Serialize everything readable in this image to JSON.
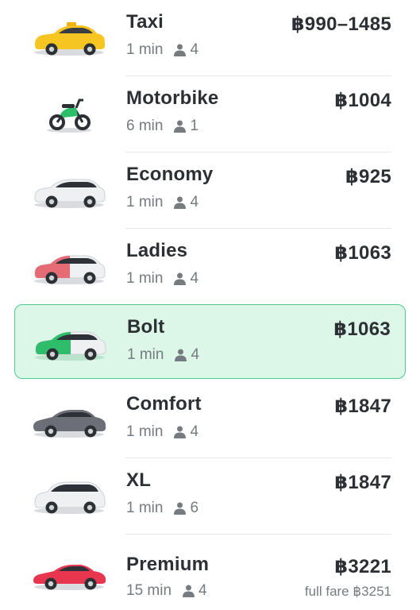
{
  "options": [
    {
      "name": "Taxi",
      "eta": "1 min",
      "seats": "4",
      "price": "฿990–1485",
      "icon": "taxi-car-icon",
      "color": "#f6c522"
    },
    {
      "name": "Motorbike",
      "eta": "6 min",
      "seats": "1",
      "price": "฿1004",
      "icon": "motorbike-icon",
      "color": "#2bbf6a"
    },
    {
      "name": "Economy",
      "eta": "1 min",
      "seats": "4",
      "price": "฿925",
      "icon": "economy-car-icon",
      "color": "#eef0f2"
    },
    {
      "name": "Ladies",
      "eta": "1 min",
      "seats": "4",
      "price": "฿1063",
      "icon": "ladies-car-icon",
      "color": "#e56b74"
    },
    {
      "name": "Bolt",
      "eta": "1 min",
      "seats": "4",
      "price": "฿1063",
      "icon": "bolt-car-icon",
      "color": "#2ebd6b",
      "selected": true
    },
    {
      "name": "Comfort",
      "eta": "1 min",
      "seats": "4",
      "price": "฿1847",
      "icon": "comfort-car-icon",
      "color": "#6c6f77"
    },
    {
      "name": "XL",
      "eta": "1 min",
      "seats": "6",
      "price": "฿1847",
      "icon": "xl-van-icon",
      "color": "#eef0f2"
    },
    {
      "name": "Premium",
      "eta": "15 min",
      "seats": "4",
      "price": "฿3221",
      "full_fare": "full fare ฿3251",
      "icon": "premium-car-icon",
      "color": "#e8364f"
    }
  ]
}
